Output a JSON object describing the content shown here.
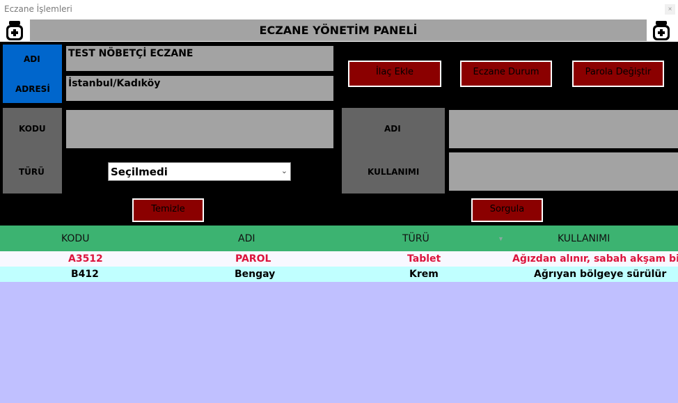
{
  "window": {
    "title": "Eczane İşlemleri",
    "close_glyph": "×"
  },
  "header": {
    "title": "ECZANE YÖNETİM PANELİ",
    "left_icon": "pill-bottle-icon",
    "right_icon": "pill-bottle-icon"
  },
  "pharmacy": {
    "name_label": "ADI",
    "address_label": "ADRESİ",
    "name_value": "TEST NÖBETÇİ ECZANE",
    "address_value": "İstanbul/Kadıköy"
  },
  "toolbar": {
    "add_drug_label": "İlaç Ekle",
    "pharmacy_status_label": "Eczane Durum",
    "change_password_label": "Parola Değiştir"
  },
  "search": {
    "code_label": "KODU",
    "type_label": "TÜRÜ",
    "code_value": "",
    "type_selected": "Seçilmedi",
    "name_label": "ADI",
    "usage_label": "KULLANIMI",
    "name_value": "",
    "usage_value": "",
    "clear_label": "Temizle",
    "query_label": "Sorgula"
  },
  "grid": {
    "columns": [
      "KODU",
      "ADI",
      "TÜRÜ",
      "KULLANIMI"
    ],
    "rows": [
      {
        "kodu": "A3512",
        "adi": "PAROL",
        "turu": "Tablet",
        "kullanimi": "Ağızdan alınır, sabah akşam bir ..."
      },
      {
        "kodu": "B412",
        "adi": "Bengay",
        "turu": "Krem",
        "kullanimi": "Ağrıyan bölgeye sürülür"
      }
    ]
  },
  "colors": {
    "background": "#000000",
    "accent_blue": "#0066cc",
    "button_red": "#8b0000",
    "grid_header": "#3cb371",
    "row_highlight_text": "#dc143c",
    "grid_empty": "#c0c0ff"
  }
}
